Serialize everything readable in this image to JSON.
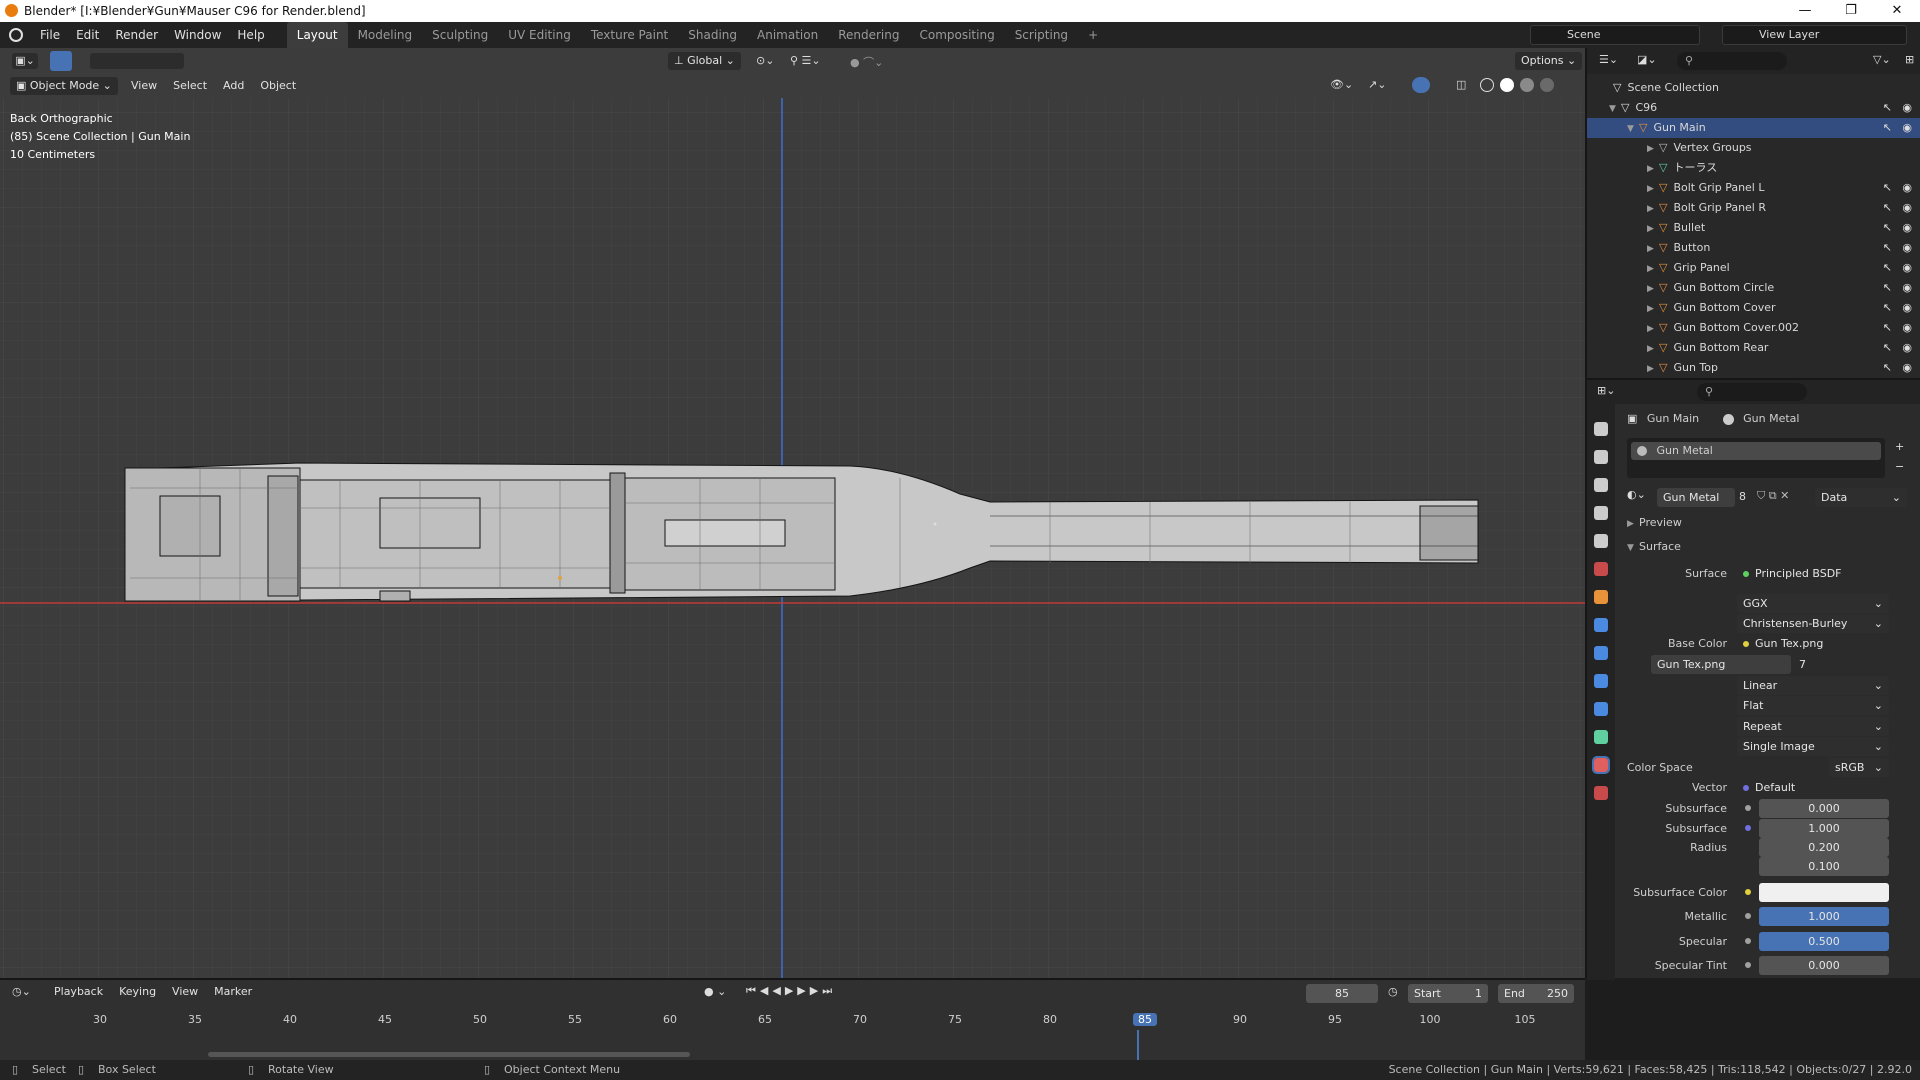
{
  "window": {
    "title": "Blender* [I:¥Blender¥Gun¥Mauser C96 for Render.blend]",
    "minimize": "—",
    "maximize": "❐",
    "close": "✕"
  },
  "menu": [
    "File",
    "Edit",
    "Render",
    "Window",
    "Help"
  ],
  "workspaces": [
    "Layout",
    "Modeling",
    "Sculpting",
    "UV Editing",
    "Texture Paint",
    "Shading",
    "Animation",
    "Rendering",
    "Compositing",
    "Scripting",
    "+"
  ],
  "active_workspace": "Layout",
  "scene": {
    "label": "Scene",
    "view_layer": "View Layer"
  },
  "viewport": {
    "mode": "Object Mode",
    "header_menus": [
      "View",
      "Select",
      "Add",
      "Object"
    ],
    "orientation": "Global",
    "options": "Options",
    "overlay_lines": [
      "Back Orthographic",
      "(85) Scene Collection | Gun Main",
      "10 Centimeters"
    ]
  },
  "outliner": {
    "root": "Scene Collection",
    "collection": "C96",
    "object": "Gun Main",
    "children": [
      "Vertex Groups",
      "トーラス",
      "Bolt Grip Panel L",
      "Bolt Grip Panel R",
      "Bullet",
      "Button",
      "Grip Panel",
      "Gun Bottom Circle",
      "Gun Bottom Cover",
      "Gun Bottom Cover.002",
      "Gun Bottom Rear",
      "Gun Top"
    ]
  },
  "properties": {
    "breadcrumb_object": "Gun Main",
    "breadcrumb_material": "Gun Metal",
    "slot": "Gun Metal",
    "material_name": "Gun Metal",
    "users": "8",
    "link": "Data",
    "preview": "Preview",
    "surface_header": "Surface",
    "surface_label": "Surface",
    "surface_value": "Principled BSDF",
    "distribution": "GGX",
    "subsurface_method": "Christensen-Burley",
    "base_color_label": "Base Color",
    "base_color_value": "Gun Tex.png",
    "image_name": "Gun Tex.png",
    "image_users": "7",
    "interpolation": "Linear",
    "projection": "Flat",
    "extension": "Repeat",
    "source": "Single Image",
    "color_space_label": "Color Space",
    "color_space": "sRGB",
    "vector_label": "Vector",
    "vector_value": "Default",
    "subsurface_label": "Subsurface",
    "subsurface_value": "0.000",
    "subsurface_radius_label": "Subsurface Radius",
    "subsurface_radius": [
      "1.000",
      "0.200",
      "0.100"
    ],
    "subsurface_color_label": "Subsurface Color",
    "metallic_label": "Metallic",
    "metallic_value": "1.000",
    "specular_label": "Specular",
    "specular_value": "0.500",
    "specular_tint_label": "Specular Tint",
    "specular_tint_value": "0.000"
  },
  "timeline": {
    "menus": [
      "Playback",
      "Keying",
      "View",
      "Marker"
    ],
    "current_frame": "85",
    "start_label": "Start",
    "start": "1",
    "end_label": "End",
    "end": "250",
    "ticks": [
      "30",
      "35",
      "40",
      "45",
      "50",
      "55",
      "60",
      "65",
      "70",
      "75",
      "80",
      "85",
      "90",
      "95",
      "100",
      "105"
    ]
  },
  "statusbar": {
    "select": "Select",
    "box_select": "Box Select",
    "rotate": "Rotate View",
    "context": "Object Context Menu",
    "stats": "Scene Collection | Gun Main | Verts:59,621 | Faces:58,425 | Tris:118,542 | Objects:0/27 | 2.92.0"
  },
  "colors": {
    "accent": "#4772b3",
    "active_frame": "#4772b3",
    "x_axis": "#c23a3a",
    "z_axis": "#3d6fd0",
    "material": "#e06060"
  }
}
